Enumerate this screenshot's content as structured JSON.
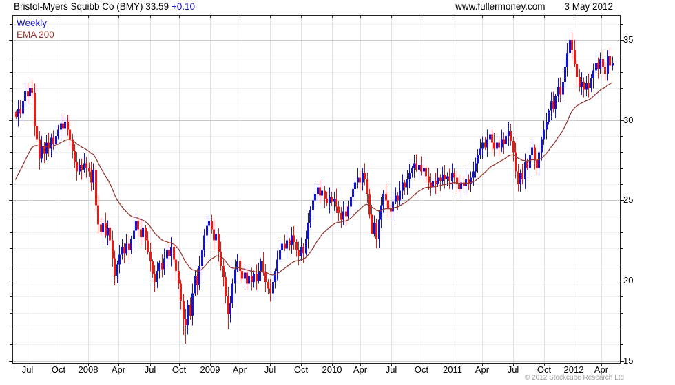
{
  "header": {
    "title": "Bristol-Myers Squibb Co (BMY) 33.59",
    "change": "+0.10",
    "source": "www.fullermoney.com",
    "date": "3 May 2012"
  },
  "legend": {
    "interval": "Weekly",
    "overlay": "EMA 200"
  },
  "footer": {
    "copyright": "© 2012 Stockcube Research Ltd"
  },
  "colors": {
    "up": "#1414cd",
    "down": "#eb1914",
    "ema": "#963732",
    "grid_vertical": "#e2e2e2",
    "grid_major": "#c8c8c8",
    "grid_minor": "#efefef",
    "axis": "#222222",
    "change_text": "#1414cd",
    "copyright_text": "#9b9b9b"
  },
  "chart_data": {
    "type": "candlestick",
    "title": "Bristol-Myers Squibb Co (BMY)",
    "last_price": 33.59,
    "change": "+0.10",
    "interval": "Weekly",
    "overlay": "EMA 200",
    "period_shown": "Jun 2007 - May 2012",
    "x_tick_labels": [
      "Jul",
      "Oct",
      "2008",
      "Apr",
      "Jul",
      "Oct",
      "2009",
      "Apr",
      "Jul",
      "Oct",
      "2010",
      "Apr",
      "Jul",
      "Oct",
      "2011",
      "Apr",
      "Jul",
      "Oct",
      "2012",
      "Apr"
    ],
    "y_tick_labels": [
      15,
      20,
      25,
      30,
      35
    ],
    "y_minor_step": 1,
    "y_range": [
      14.85,
      36.55
    ],
    "legend_position": "top-left",
    "grid": true,
    "weekly_closes": [
      30.2,
      30.7,
      30.4,
      31.2,
      31.8,
      31.5,
      32.0,
      31.7,
      29.6,
      28.8,
      27.6,
      28.4,
      27.9,
      28.6,
      28.2,
      28.9,
      28.5,
      29.0,
      29.4,
      29.8,
      29.5,
      29.9,
      29.4,
      28.8,
      28.1,
      27.4,
      26.8,
      27.2,
      26.9,
      27.3,
      27.0,
      26.8,
      26.1,
      26.9,
      24.7,
      23.5,
      23.0,
      23.6,
      22.8,
      23.3,
      22.5,
      21.4,
      20.3,
      21.0,
      21.6,
      22.1,
      21.7,
      22.3,
      21.9,
      22.6,
      23.1,
      23.7,
      23.2,
      22.7,
      23.3,
      22.5,
      21.8,
      21.2,
      20.4,
      19.9,
      20.6,
      21.1,
      20.7,
      21.4,
      21.9,
      21.5,
      22.1,
      21.3,
      20.6,
      19.8,
      18.7,
      17.6,
      17.2,
      18.5,
      17.8,
      19.2,
      20.3,
      19.7,
      20.9,
      21.9,
      22.8,
      23.4,
      23.7,
      23.2,
      22.5,
      22.9,
      21.8,
      20.9,
      20.2,
      19.0,
      17.9,
      18.6,
      19.8,
      20.7,
      21.2,
      20.6,
      20.1,
      20.5,
      19.8,
      20.3,
      19.9,
      20.4,
      20.0,
      20.6,
      21.2,
      20.5,
      19.9,
      19.5,
      19.2,
      19.9,
      20.6,
      21.3,
      21.9,
      22.3,
      22.0,
      22.5,
      22.2,
      22.8,
      22.4,
      21.9,
      21.5,
      22.1,
      21.7,
      22.6,
      23.6,
      24.4,
      25.0,
      25.4,
      25.8,
      25.3,
      25.6,
      25.1,
      24.8,
      25.2,
      24.9,
      25.1,
      24.6,
      24.2,
      23.8,
      24.3,
      24.0,
      24.6,
      25.2,
      25.7,
      26.1,
      26.4,
      26.1,
      26.7,
      26.3,
      25.4,
      24.1,
      22.9,
      23.6,
      22.6,
      23.8,
      24.7,
      25.4,
      25.0,
      24.5,
      24.3,
      24.9,
      25.3,
      25.0,
      25.6,
      26.1,
      25.8,
      26.3,
      26.7,
      27.0,
      27.3,
      26.9,
      27.2,
      26.8,
      27.0,
      26.5,
      26.1,
      25.8,
      26.2,
      26.0,
      26.4,
      26.2,
      26.6,
      26.3,
      26.5,
      26.2,
      26.7,
      26.4,
      26.0,
      25.7,
      26.1,
      25.9,
      26.3,
      26.0,
      26.4,
      26.8,
      27.3,
      27.8,
      28.2,
      28.6,
      28.3,
      28.8,
      29.1,
      28.6,
      28.2,
      28.6,
      28.3,
      28.8,
      28.5,
      29.0,
      29.3,
      28.7,
      28.0,
      26.8,
      26.0,
      26.7,
      26.3,
      27.4,
      27.0,
      27.8,
      28.3,
      27.5,
      27.0,
      28.0,
      28.8,
      29.4,
      29.9,
      30.6,
      31.2,
      30.7,
      31.5,
      32.1,
      31.6,
      32.4,
      33.3,
      34.2,
      35.0,
      34.4,
      33.5,
      32.7,
      32.1,
      32.4,
      31.9,
      32.3,
      32.0,
      32.6,
      33.1,
      33.6,
      33.2,
      33.8,
      33.3,
      32.9,
      34.0,
      33.4,
      33.59
    ],
    "wick_overrides": {
      "10": {
        "low": 26.9
      },
      "42": {
        "low": 19.7
      },
      "71": {
        "low": 16.6
      },
      "72": {
        "low": 16.05
      },
      "90": {
        "low": 16.95
      },
      "151": {
        "low": 23.2
      },
      "154": {
        "low": 22.05
      },
      "214": {
        "low": 25.5
      },
      "235": {
        "high": 35.45
      },
      "252": {
        "high": 34.55
      }
    },
    "ema": {
      "label": "EMA 200",
      "period_weeks": 28,
      "seed": 26.0
    }
  }
}
